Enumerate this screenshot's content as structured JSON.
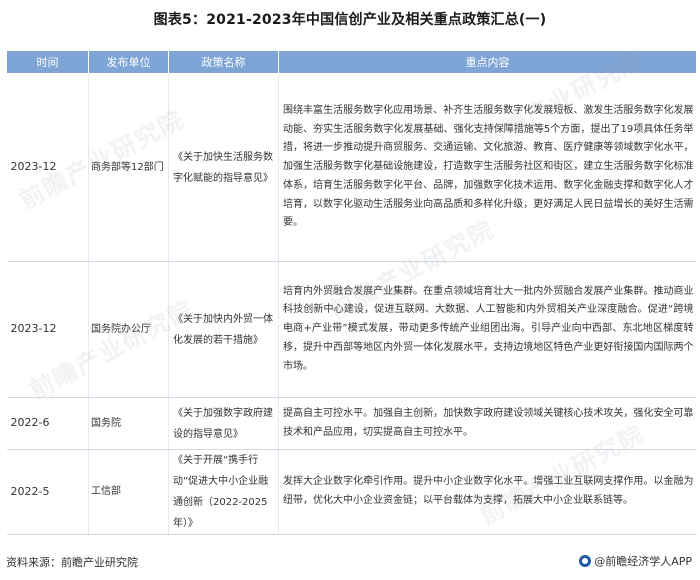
{
  "title": "图表5：2021-2023年中国信创产业及相关重点政策汇总(一)",
  "headers": {
    "time": "时间",
    "unit": "发布单位",
    "policy": "政策名称",
    "content": "重点内容"
  },
  "rows": [
    {
      "time": "2023-12",
      "unit": "商务部等12部门",
      "policy": "《关于加快生活服务数字化赋能的指导意见》",
      "content": "围绕丰富生活服务数字化应用场景、补齐生活服务数字化发展短板、激发生活服务数字化发展动能、夯实生活服务数字化发展基础、强化支持保障措施等5个方面，提出了19项具体任务举措，将进一步推动提升商贸服务、交通运输、文化旅游、教育、医疗健康等领域数字化水平，加强生活服务数字化基础设施建设，打造数字生活服务社区和街区，建立生活服务数字化标准体系，培育生活服务数字化平台、品牌，加强数字化技术运用、数字化金融支撑和数字化人才培育，以数字化驱动生活服务业向高品质和多样化升级，更好满足人民日益增长的美好生活需要。"
    },
    {
      "time": "2023-12",
      "unit": "国务院办公厅",
      "policy": "《关于加快内外贸一体化发展的若干措施》",
      "content": "培育内外贸融合发展产业集群。在重点领域培育壮大一批内外贸融合发展产业集群。推动商业科技创新中心建设，促进互联网、大数据、人工智能和内外贸相关产业深度融合。促进“跨境电商+产业带”模式发展，带动更多传统产业组团出海。引导产业向中西部、东北地区梯度转移，提升中西部等地区内外贸一体化发展水平，支持边境地区特色产业更好衔接国内国际两个市场。"
    },
    {
      "time": "2022-6",
      "unit": "国务院",
      "policy": "《关于加强数字政府建设的指导意见》",
      "content": "提高自主可控水平。加强自主创新，加快数字政府建设领域关键核心技术攻关，强化安全可靠技术和产品应用，切实提高自主可控水平。"
    },
    {
      "time": "2022-5",
      "unit": "工信部",
      "policy": "《关于开展“携手行动”促进大中小企业融通创新（2022-2025年）》",
      "content": "发挥大企业数字化牵引作用。提升中小企业数字化水平。增强工业互联网支撑作用。以金融为纽带，优化大中小企业资金链；以平台载体为支撑，拓展大中小企业联系链等。"
    }
  ],
  "footer": {
    "source": "资料来源：前瞻产业研究院",
    "brand": "@前瞻经济学人APP"
  },
  "watermark": {
    "text": "前瞻产业研究院"
  },
  "colors": {
    "header_bg": "#7fa4d6",
    "header_text": "#ffffff",
    "brand_blue": "#1e5aa8"
  }
}
